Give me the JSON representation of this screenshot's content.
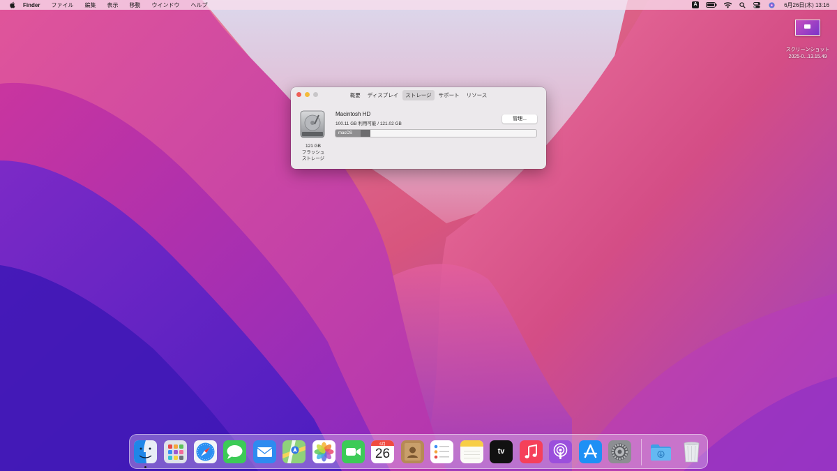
{
  "menubar": {
    "apple_icon": "apple-logo-icon",
    "items": [
      "Finder",
      "ファイル",
      "編集",
      "表示",
      "移動",
      "ウインドウ",
      "ヘルプ"
    ],
    "status_icons": [
      "input-source-icon",
      "battery-icon",
      "wifi-icon",
      "spotlight-search-icon",
      "control-center-icon",
      "siri-icon"
    ],
    "input_source_label": "A",
    "clock": "6月26日(木)  13:16"
  },
  "desktop": {
    "file_name_line1": "スクリーンショット",
    "file_name_line2": "2025-0...13.15.49"
  },
  "about_window": {
    "tabs": [
      "概要",
      "ディスプレイ",
      "ストレージ",
      "サポート",
      "リソース"
    ],
    "active_tab": "ストレージ",
    "drive": {
      "capacity": "121 GB",
      "type_line1": "フラッシュ",
      "type_line2": "ストレージ"
    },
    "disk_name": "Macintosh HD",
    "availability": "100.11 GB 利用可能 / 121.02 GB",
    "manage_button": "管理...",
    "storage_bar": {
      "segment_label": "macOS",
      "macos_fraction": 0.125,
      "other_fraction": 0.047
    }
  },
  "dock": {
    "apps": [
      {
        "name": "Finder",
        "icon": "finder-icon"
      },
      {
        "name": "Launchpad",
        "icon": "launchpad-icon"
      },
      {
        "name": "Safari",
        "icon": "safari-icon"
      },
      {
        "name": "メッセージ",
        "icon": "messages-icon"
      },
      {
        "name": "メール",
        "icon": "mail-icon"
      },
      {
        "name": "マップ",
        "icon": "maps-icon"
      },
      {
        "name": "写真",
        "icon": "photos-icon"
      },
      {
        "name": "FaceTime",
        "icon": "facetime-icon"
      },
      {
        "name": "カレンダー",
        "icon": "calendar-icon"
      },
      {
        "name": "連絡先",
        "icon": "contacts-icon"
      },
      {
        "name": "リマインダー",
        "icon": "reminders-icon"
      },
      {
        "name": "メモ",
        "icon": "notes-icon"
      },
      {
        "name": "TV",
        "icon": "apple-tv-icon"
      },
      {
        "name": "ミュージック",
        "icon": "music-icon"
      },
      {
        "name": "Podcast",
        "icon": "podcasts-icon"
      },
      {
        "name": "App Store",
        "icon": "app-store-icon"
      },
      {
        "name": "システム環境設定",
        "icon": "system-preferences-icon"
      },
      {
        "name": "ダウンロード",
        "icon": "downloads-folder-icon"
      },
      {
        "name": "ゴミ箱",
        "icon": "trash-icon"
      }
    ],
    "calendar_month": "6月",
    "calendar_day": "26",
    "tv_label": "tv"
  }
}
